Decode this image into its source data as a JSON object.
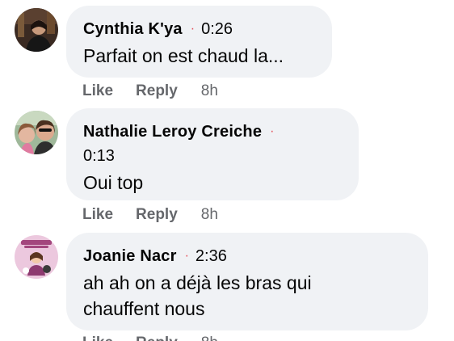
{
  "comments": [
    {
      "author": "Cynthia K'ya",
      "separator": "·",
      "timestamp": "0:26",
      "text": "Parfait on est chaud la...",
      "actions": {
        "like": "Like",
        "reply": "Reply",
        "age": "8h"
      },
      "avatar": "profile-photo"
    },
    {
      "author": "Nathalie Leroy Creiche",
      "separator": "·",
      "timestamp": "0:13",
      "text": "Oui top",
      "actions": {
        "like": "Like",
        "reply": "Reply",
        "age": "8h"
      },
      "avatar": "profile-photo"
    },
    {
      "author": "Joanie Nacr",
      "separator": "·",
      "timestamp": "2:36",
      "text_lines": [
        "ah ah on a déjà les bras qui",
        "chauffent nous"
      ],
      "actions": {
        "like": "Like",
        "reply": "Reply",
        "age": "8h"
      },
      "avatar": "profile-illustration"
    }
  ],
  "colors": {
    "bubble": "#f0f2f5",
    "separator_dot": "#e4505a",
    "action_text": "#65676b",
    "text": "#050505"
  }
}
